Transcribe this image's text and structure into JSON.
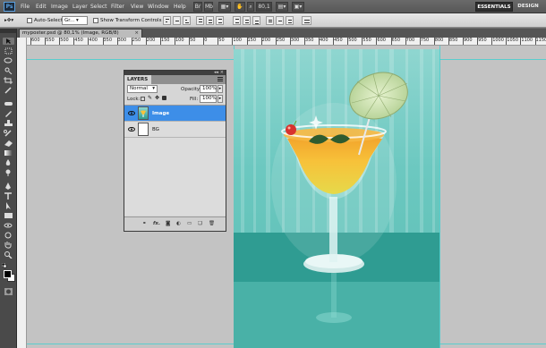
{
  "app": {
    "logo": "Ps"
  },
  "menubar": {
    "items": [
      "File",
      "Edit",
      "Image",
      "Layer",
      "Select",
      "Filter",
      "View",
      "Window",
      "Help"
    ],
    "zoom": "80,1",
    "workspaces": {
      "active": "ESSENTIALS",
      "other": "DESIGN"
    }
  },
  "options": {
    "auto_select_label": "Auto-Select:",
    "auto_select_value": "Gr...",
    "show_transform_label": "Show Transform Controls"
  },
  "document": {
    "tab_title": "myposter.psd @ 80,1% (Image, RGB/8)",
    "close_glyph": "×"
  },
  "ruler": {
    "labels": [
      "600",
      "550",
      "500",
      "450",
      "400",
      "350",
      "300",
      "250",
      "200",
      "150",
      "100",
      "50",
      "0",
      "50",
      "100",
      "150",
      "200",
      "250",
      "300",
      "350",
      "400",
      "450",
      "500",
      "550",
      "600",
      "650",
      "700",
      "750",
      "800",
      "850",
      "900",
      "950",
      "1000",
      "1050",
      "1100",
      "1150",
      "1200"
    ]
  },
  "layers_panel": {
    "tab": "LAYERS",
    "blend_mode": "Normal",
    "opacity_label": "Opacity:",
    "opacity_value": "100%",
    "lock_label": "Lock:",
    "fill_label": "Fill:",
    "fill_value": "100%",
    "layers": [
      {
        "name": "Image",
        "active": true
      },
      {
        "name": "BG",
        "active": false
      }
    ],
    "footer_icons": [
      "link-icon",
      "fx-icon",
      "mask-icon",
      "adjustment-icon",
      "folder-icon",
      "new-layer-icon",
      "trash-icon"
    ],
    "footer_fx": "fx."
  },
  "colors": {
    "accent": "#3d8ee8",
    "poster_top": "#8fd6d0",
    "poster_bottom": "#2e9c92",
    "guides": "#40d0d0"
  }
}
